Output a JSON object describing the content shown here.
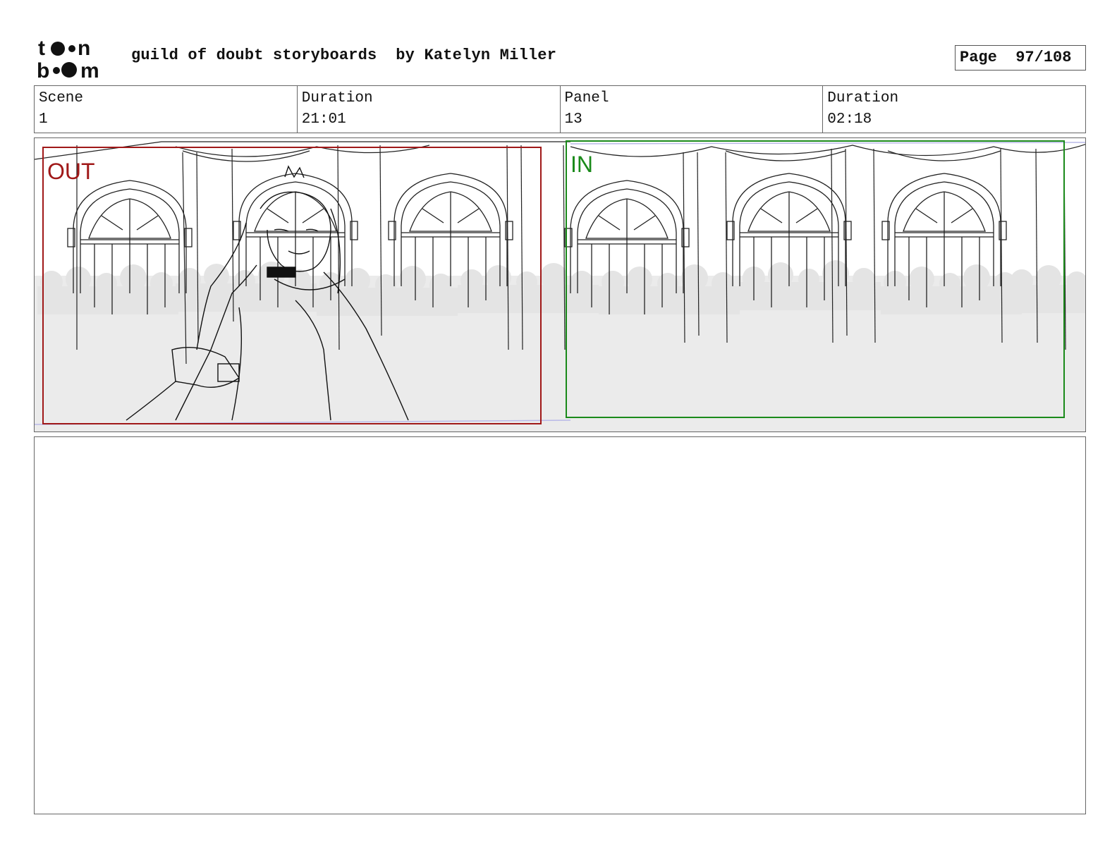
{
  "header": {
    "logo_text_top": "toon",
    "logo_text_bottom": "boom",
    "title": "guild of doubt storyboards  by Katelyn Miller",
    "page_label": "Page  97/108"
  },
  "info": {
    "scene_label": "Scene",
    "scene_value": "1",
    "duration_label": "Duration",
    "duration_value": "21:01",
    "panel_label": "Panel",
    "panel_value": "13",
    "panel_duration_label": "Duration",
    "panel_duration_value": "02:18"
  },
  "panel": {
    "out_label": "OUT",
    "in_label": "IN",
    "out_color": "#a01818",
    "in_color": "#1a8a1a"
  },
  "notes": {
    "text": ""
  }
}
